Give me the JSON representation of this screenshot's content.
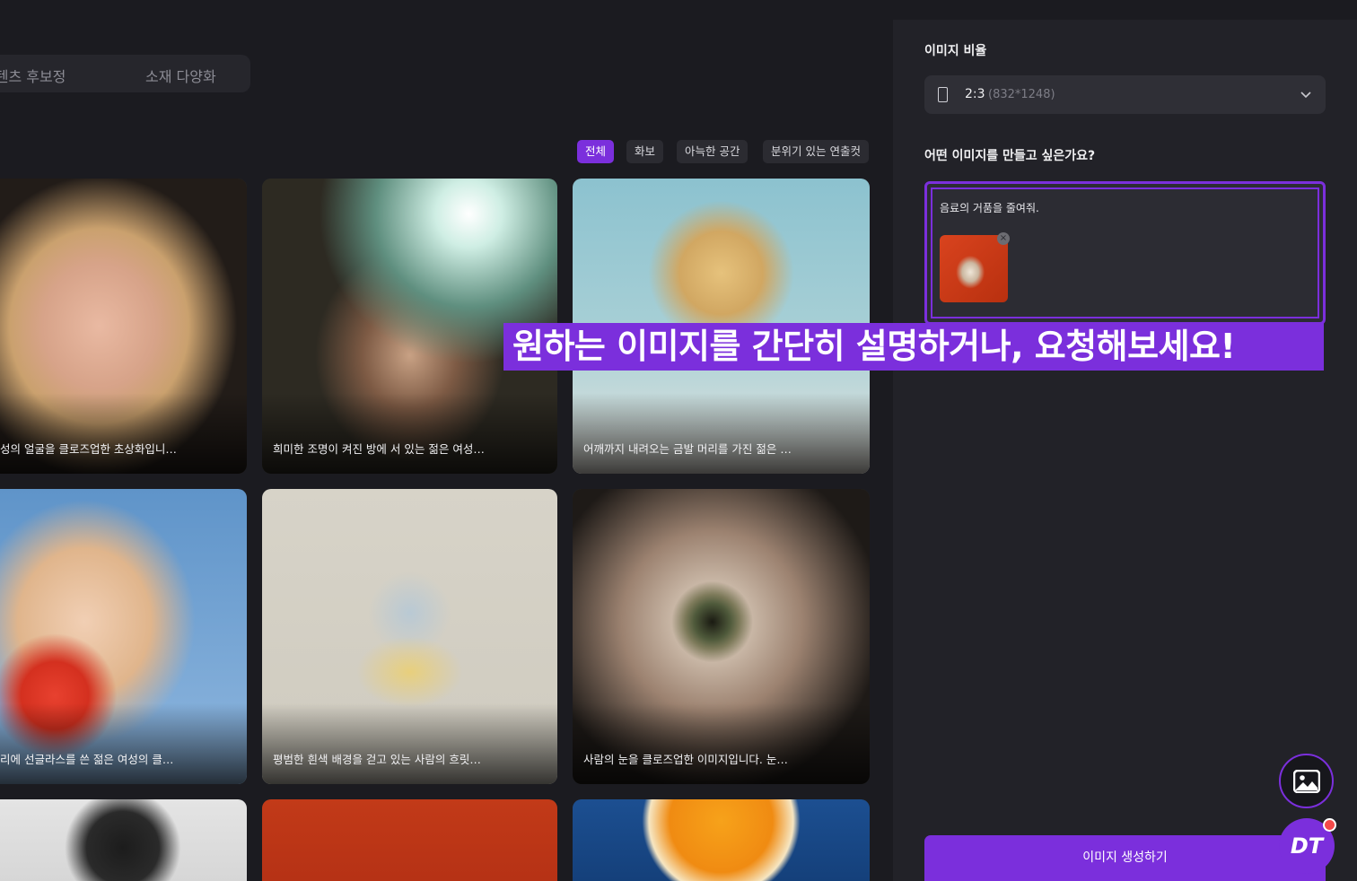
{
  "mode_tabs": [
    "콘텐츠 후보정",
    "소재 다양화"
  ],
  "filters": [
    {
      "label": "전체",
      "active": true
    },
    {
      "label": "화보",
      "active": false
    },
    {
      "label": "아늑한 공간",
      "active": false
    },
    {
      "label": "분위기 있는 연출컷",
      "active": false
    }
  ],
  "gallery": {
    "cards": [
      {
        "caption": "성의 얼굴을 클로즈업한 초상화입니…"
      },
      {
        "caption": "희미한 조명이 켜진 방에 서 있는 젊은 여성…"
      },
      {
        "caption": "어깨까지 내려오는 금발 머리를 가진 젊은 …"
      },
      {
        "caption": "리에 선글라스를 쓴 젊은 여성의 클…"
      },
      {
        "caption": "평범한 흰색 배경을 걷고 있는 사람의 흐릿…"
      },
      {
        "caption": "사람의 눈을 클로즈업한 이미지입니다. 눈…"
      }
    ]
  },
  "panel": {
    "ratio_label": "이미지 비율",
    "ratio_value": "2:3",
    "ratio_dims": "(832*1248)",
    "prompt_label": "어떤 이미지를 만들고 싶은가요?",
    "prompt_text": "음료의 거품을 줄여줘.",
    "generate_button": "이미지 생성하기"
  },
  "banner_text": "원하는 이미지를 간단히 설명하거나, 요청해보세요!",
  "fab": {
    "dt_label": "DT"
  },
  "colors": {
    "accent": "#7b2fdc",
    "background": "#1b1b20",
    "panel": "#222228"
  }
}
